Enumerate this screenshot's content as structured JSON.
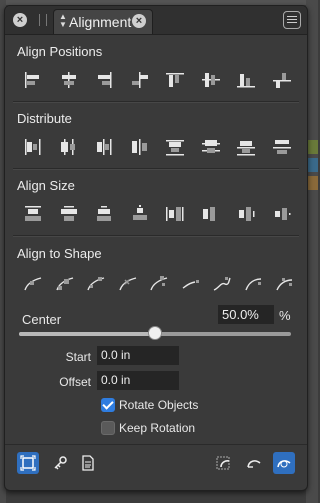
{
  "tab": {
    "title": "Alignment",
    "arrows": "◆"
  },
  "sections": {
    "align_positions": "Align Positions",
    "distribute": "Distribute",
    "align_size": "Align Size",
    "align_to_shape": "Align to Shape"
  },
  "center": {
    "label": "Center",
    "value": "50.0%",
    "unit": "%",
    "fraction": 0.5
  },
  "start": {
    "label": "Start",
    "value": "0.0 in"
  },
  "offset": {
    "label": "Offset",
    "value": "0.0 in"
  },
  "options": {
    "rotate_objects": {
      "label": "Rotate Objects",
      "checked": true
    },
    "keep_rotation": {
      "label": "Keep Rotation",
      "checked": false
    }
  },
  "colors": {
    "accent": "#2f7de0",
    "panel": "#3a3a3a",
    "field": "#252525"
  }
}
